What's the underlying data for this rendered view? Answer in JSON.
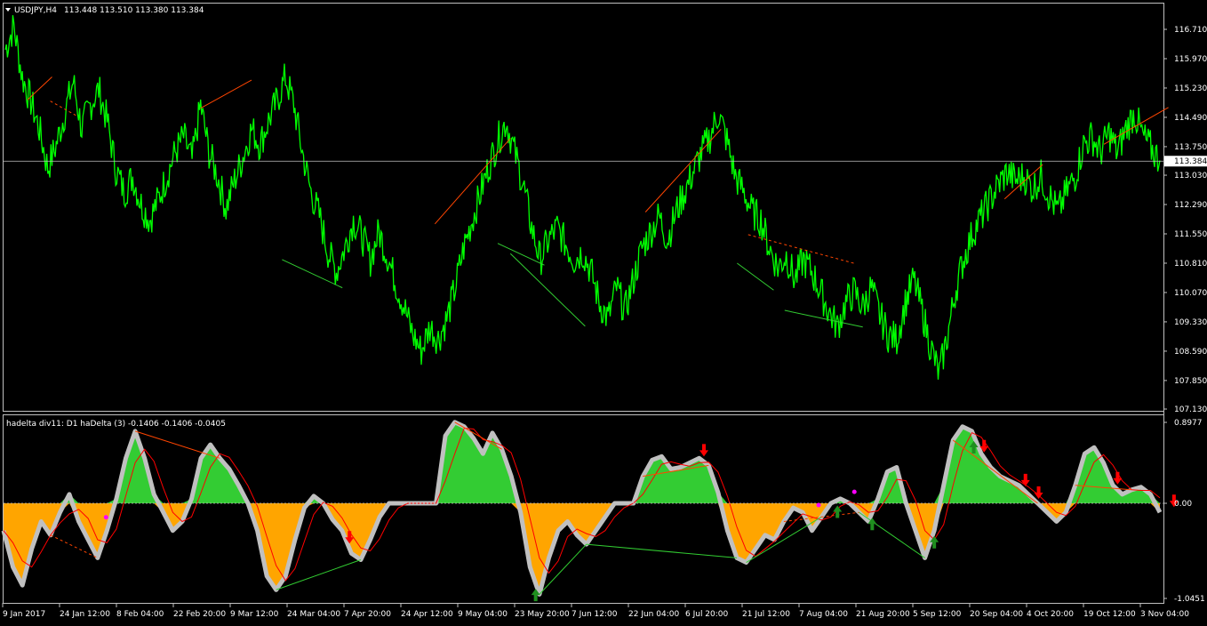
{
  "chart_data": [
    {
      "type": "line",
      "header": {
        "symbol": "USDJPY,H4",
        "ohlc": "113.448 113.510 113.380 113.384"
      },
      "y_ticks": [
        "116.710",
        "115.970",
        "115.230",
        "114.490",
        "113.750",
        "113.030",
        "112.290",
        "111.550",
        "110.810",
        "110.070",
        "109.330",
        "108.590",
        "107.850",
        "107.130"
      ],
      "ylim": [
        107.13,
        117.2
      ],
      "current_price_label": "113.384",
      "current_price": 113.384,
      "series": [
        {
          "values": [
            116.2,
            116.8,
            115.5,
            114.9,
            114.2,
            113.2,
            113.8,
            114.6,
            115.4,
            114.2,
            114.8,
            115.2,
            114.4,
            113.2,
            112.6,
            113.0,
            112.3,
            111.9,
            112.4,
            113.0,
            113.6,
            114.0,
            113.4,
            114.8,
            113.6,
            113.0,
            112.2,
            112.9,
            113.5,
            114.2,
            113.8,
            114.4,
            114.9,
            115.5,
            114.8,
            113.6,
            112.6,
            112.0,
            111.1,
            110.6,
            111.2,
            111.9,
            111.5,
            110.9,
            111.6,
            111.0,
            110.3,
            109.7,
            109.0,
            108.6,
            109.2,
            108.9,
            109.4,
            110.2,
            111.2,
            111.9,
            112.6,
            113.3,
            113.9,
            114.4,
            113.6,
            112.8,
            111.7,
            110.9,
            111.4,
            111.7,
            111.3,
            110.9,
            111.1,
            110.6,
            109.8,
            109.4,
            110.2,
            109.6,
            110.4,
            111.2,
            111.6,
            112.0,
            111.4,
            112.1,
            112.6,
            113.1,
            113.6,
            114.0,
            114.6,
            113.9,
            113.0,
            112.6,
            112.1,
            111.9,
            111.2,
            110.7,
            111.0,
            110.4,
            110.9,
            110.6,
            110.1,
            109.6,
            109.2,
            109.8,
            110.1,
            109.7,
            110.2,
            109.5,
            109.0,
            108.9,
            109.8,
            110.4,
            109.6,
            108.7,
            108.0,
            109.0,
            110.2,
            111.0,
            111.6,
            112.0,
            112.4,
            112.8,
            113.1,
            112.9,
            113.0,
            112.7,
            113.0,
            112.5,
            112.1,
            112.6,
            113.0,
            113.8,
            114.0,
            113.6,
            114.1,
            113.6,
            114.2,
            114.6,
            114.0,
            113.7,
            113.4
          ]
        }
      ],
      "annotations": {
        "upper_trendlines_red": [
          [
            2.6,
            114.93,
            5.5,
            115.51
          ],
          [
            23.0,
            114.72,
            29.0,
            115.43
          ],
          [
            50.6,
            111.8,
            59.5,
            113.96
          ],
          [
            75.4,
            112.1,
            84.3,
            114.19
          ],
          [
            117.7,
            112.43,
            122.2,
            113.3
          ],
          [
            129.4,
            113.81,
            137.0,
            114.74
          ]
        ],
        "upper_trendlines_green": [
          [
            32.6,
            110.9,
            39.7,
            110.19
          ],
          [
            58.0,
            111.31,
            63.5,
            110.76
          ],
          [
            59.5,
            111.05,
            68.3,
            109.22
          ],
          [
            86.2,
            110.81,
            90.5,
            110.13
          ],
          [
            91.8,
            109.62,
            101.0,
            109.2
          ]
        ],
        "upper_dashed_red": [
          [
            5.3,
            114.9,
            8.3,
            114.54
          ],
          [
            87.5,
            111.53,
            100.1,
            110.8
          ]
        ]
      }
    },
    {
      "type": "area",
      "header": "hadelta div11: D1 haDelta (3) -0.1406 -0.1406 -0.0405",
      "y_ticks": [
        "0.8977",
        "0.00",
        "-1.0451"
      ],
      "ylim": [
        -1.0451,
        0.8977
      ],
      "current_value_label": "0.00",
      "values": [
        -0.3,
        -0.7,
        -0.9,
        -0.5,
        -0.2,
        -0.35,
        -0.1,
        0.1,
        -0.2,
        -0.4,
        -0.6,
        -0.3,
        0.05,
        0.5,
        0.8,
        0.5,
        0.1,
        -0.1,
        -0.3,
        -0.2,
        0.05,
        0.5,
        0.65,
        0.5,
        0.38,
        0.2,
        0.0,
        -0.3,
        -0.8,
        -0.95,
        -0.8,
        -0.4,
        -0.05,
        0.08,
        0.0,
        -0.18,
        -0.3,
        -0.55,
        -0.62,
        -0.4,
        -0.15,
        0.0,
        0.0,
        0.0,
        0.0,
        0.0,
        0.0,
        0.75,
        0.9,
        0.85,
        0.72,
        0.55,
        0.78,
        0.6,
        0.3,
        -0.1,
        -0.7,
        -1.0,
        -0.6,
        -0.3,
        -0.2,
        -0.35,
        -0.45,
        -0.3,
        -0.15,
        0.0,
        0.0,
        0.0,
        0.3,
        0.48,
        0.52,
        0.38,
        0.4,
        0.45,
        0.5,
        0.42,
        0.12,
        -0.3,
        -0.6,
        -0.65,
        -0.5,
        -0.35,
        -0.4,
        -0.2,
        -0.05,
        -0.1,
        -0.3,
        -0.15,
        0.0,
        0.05,
        0.0,
        -0.1,
        -0.2,
        0.05,
        0.35,
        0.4,
        0.0,
        -0.3,
        -0.6,
        -0.3,
        0.2,
        0.7,
        0.85,
        0.8,
        0.55,
        0.4,
        0.3,
        0.25,
        0.2,
        0.1,
        0.0,
        -0.1,
        -0.2,
        -0.1,
        0.2,
        0.55,
        0.62,
        0.45,
        0.2,
        0.1,
        0.15,
        0.18,
        0.1,
        -0.1
      ]
    }
  ],
  "xaxis": {
    "tick_labels": [
      "9 Jan 2017",
      "24 Jan 12:00",
      "8 Feb 04:00",
      "22 Feb 20:00",
      "9 Mar 12:00",
      "24 Mar 04:00",
      "7 Apr 20:00",
      "24 Apr 12:00",
      "9 May 04:00",
      "23 May 20:00",
      "7 Jun 12:00",
      "22 Jun 04:00",
      "6 Jul 20:00",
      "21 Jul 12:00",
      "7 Aug 04:00",
      "21 Aug 20:00",
      "5 Sep 12:00",
      "20 Sep 04:00",
      "4 Oct 20:00",
      "19 Oct 12:00",
      "3 Nov 04:00"
    ]
  },
  "colors": {
    "background": "#000000",
    "price": "#00ff00",
    "up_area": "#33cc33",
    "down_area": "#ffa500",
    "shadow": "#c0c0c0",
    "signal": "#ff0000",
    "trend_red": "#ff4500",
    "trend_green": "#32cd32",
    "arrow_down": "#ff0000",
    "arrow_up": "#1f8f1f",
    "dot": "#ff00ff",
    "axis": "#c0c0c0",
    "text": "#ffffff",
    "price_tag_bg": "#ffffff",
    "price_tag_text": "#000000"
  },
  "markers": {
    "down_arrows_at": [
      36.8,
      74.5,
      104.3,
      108.7,
      110.1,
      118.5,
      124.5
    ],
    "up_arrows_at": [
      56.6,
      88.7,
      92.4,
      99.0,
      103.2
    ],
    "dots_at": [
      10.9,
      86.7,
      90.5
    ]
  }
}
